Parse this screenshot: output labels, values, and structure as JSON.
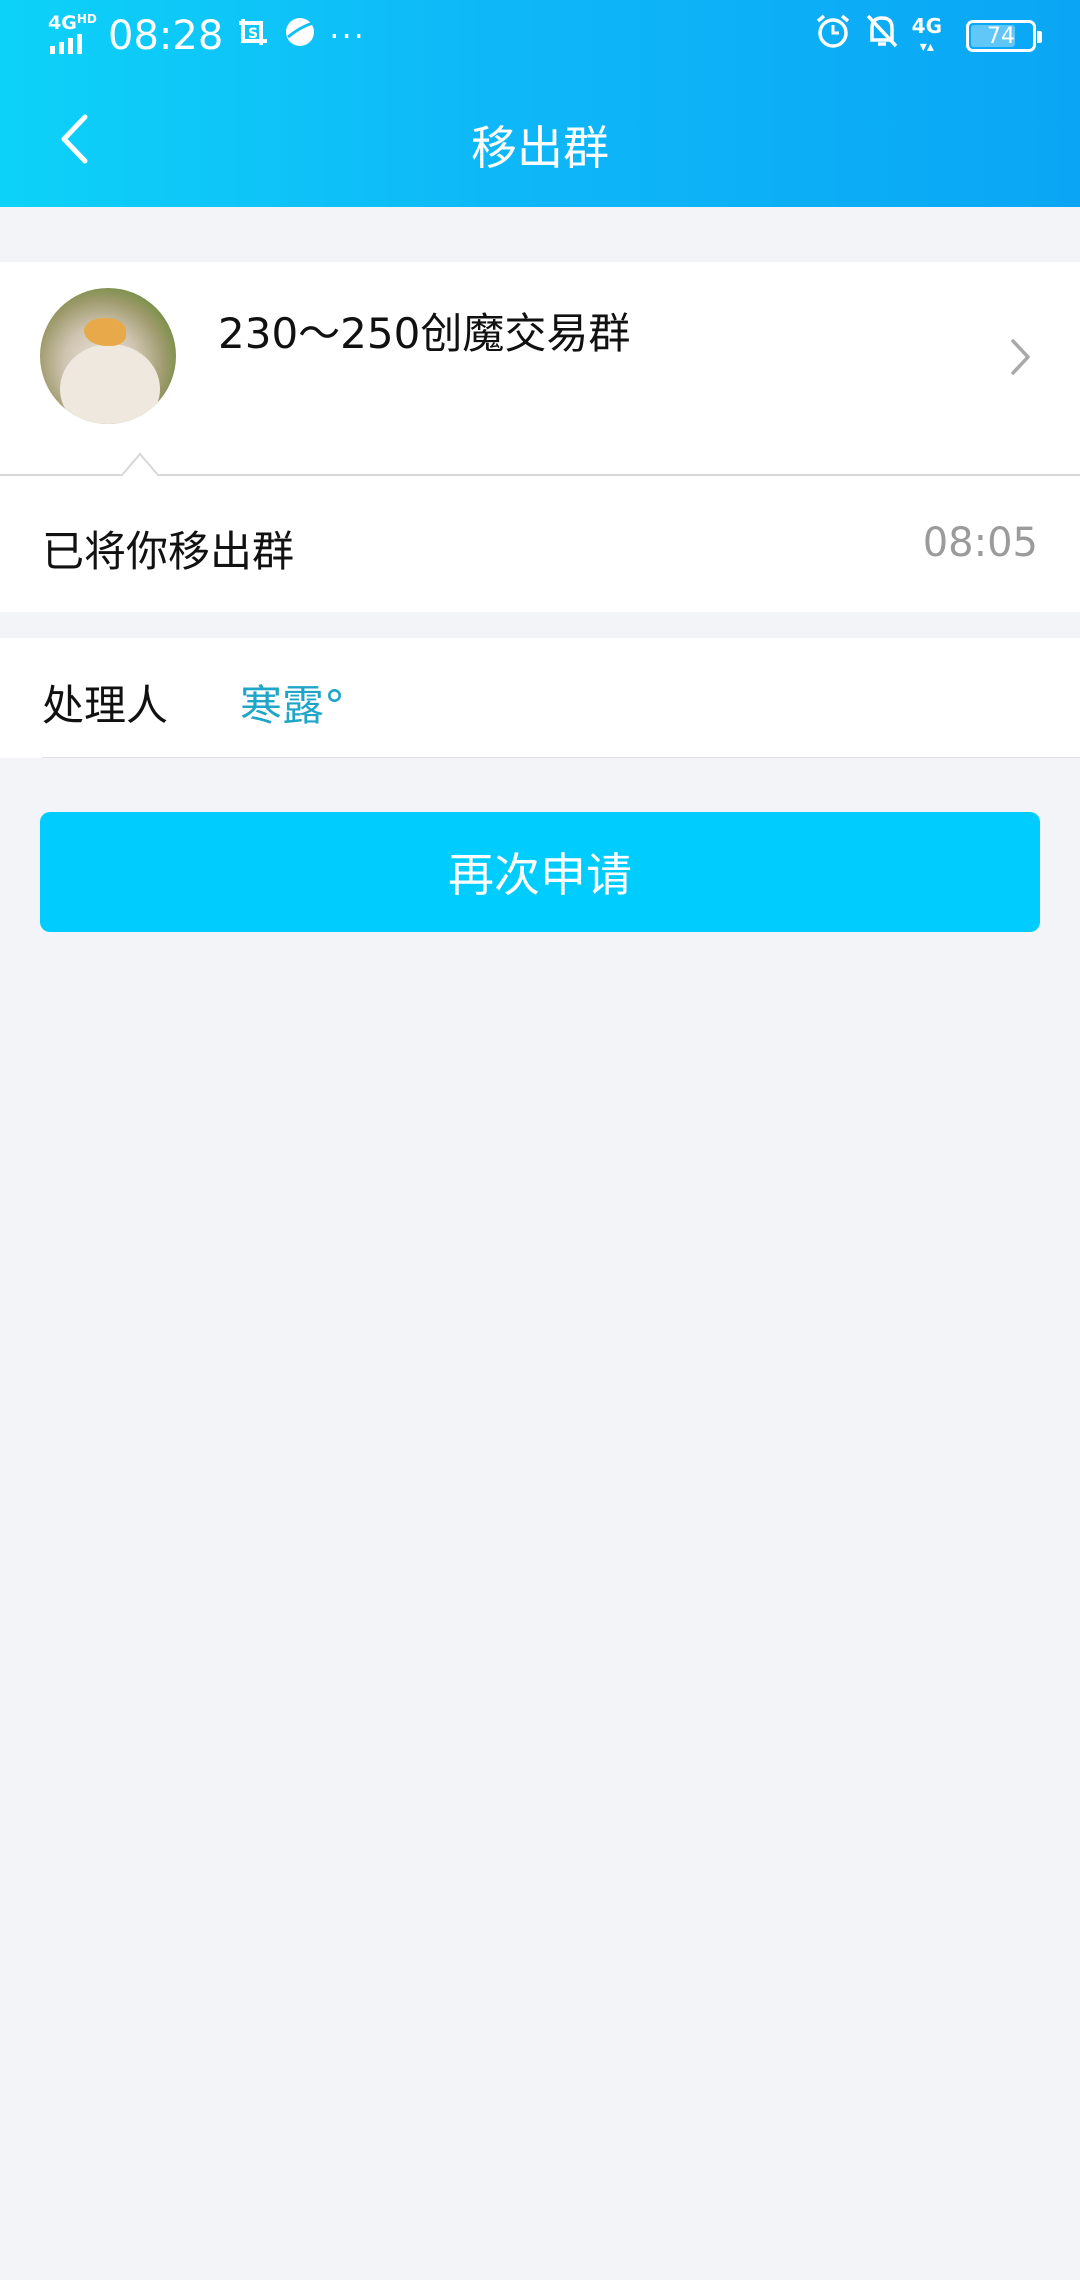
{
  "status_bar": {
    "network_left": "4G",
    "network_hd": "HD",
    "time": "08:28",
    "icons": [
      "screenshot-icon",
      "browser-icon",
      "more-dots-icon",
      "alarm-icon",
      "silent-bell-icon",
      "signal-4g-icon"
    ],
    "more_dots": "···",
    "network_right": "4G",
    "battery_level": 74,
    "battery_text": "74"
  },
  "header": {
    "title": "移出群",
    "back_icon": "chevron-left-icon"
  },
  "group": {
    "name": "230～250创魔交易群",
    "chevron_icon": "chevron-right-icon"
  },
  "message": {
    "text": "已将你移出群",
    "time": "08:05"
  },
  "handler": {
    "label": "处理人",
    "name": "寒露°"
  },
  "actions": {
    "reapply_label": "再次申请"
  },
  "colors": {
    "header_start": "#0dd2f8",
    "header_end": "#0aa6f5",
    "button": "#00ccfe",
    "link": "#1ea5c8",
    "background": "#f3f4f8"
  }
}
